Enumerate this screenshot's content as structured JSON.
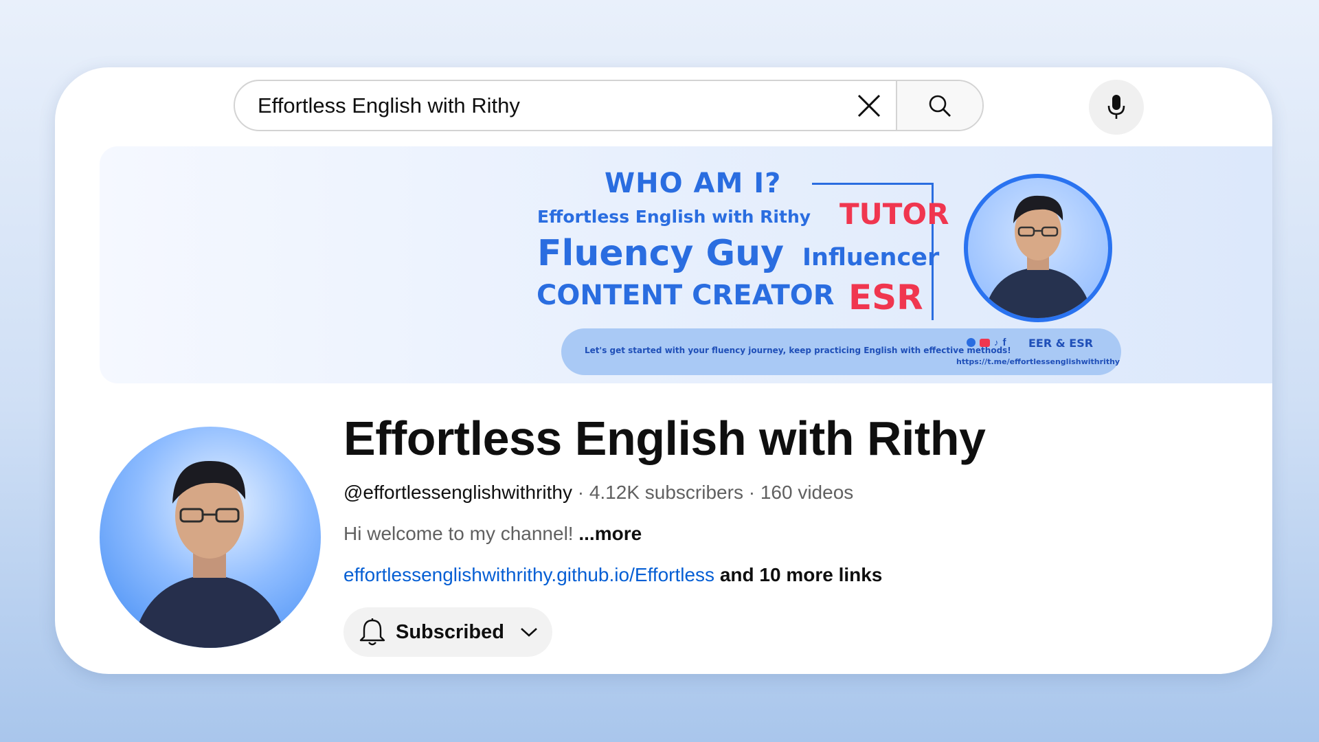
{
  "search": {
    "query": "Effortless English with Rithy"
  },
  "banner": {
    "who_am_i": "WHO AM I?",
    "name": "Effortless English with Rithy",
    "tutor": "TUTOR",
    "fluency_guy": "Fluency Guy",
    "influencer": "Influencer",
    "content_creator": "CONTENT CREATOR",
    "esr": "ESR",
    "tagline": "Let's get started with your fluency journey, keep practicing English with effective methods!",
    "social_label": "EER & ESR",
    "link": "https://t.me/effortlessenglishwithrithy"
  },
  "channel": {
    "title": "Effortless English with Rithy",
    "handle": "@effortlessenglishwithrithy",
    "subscribers": "4.12K subscribers",
    "videos": "160 videos",
    "separator": " · ",
    "description": "Hi welcome to my channel! ",
    "more": "...more",
    "link_url": "effortlessenglishwithrithy.github.io/Effortless",
    "more_links": " and 10 more links",
    "subscribe_label": "Subscribed"
  },
  "colors": {
    "accent_blue": "#2a6de0",
    "accent_red": "#f0364f",
    "link_blue": "#065fd4"
  },
  "icons": {
    "clear": "close-icon",
    "search": "search-icon",
    "mic": "microphone-icon",
    "bell": "bell-icon",
    "chevron": "chevron-down-icon"
  }
}
